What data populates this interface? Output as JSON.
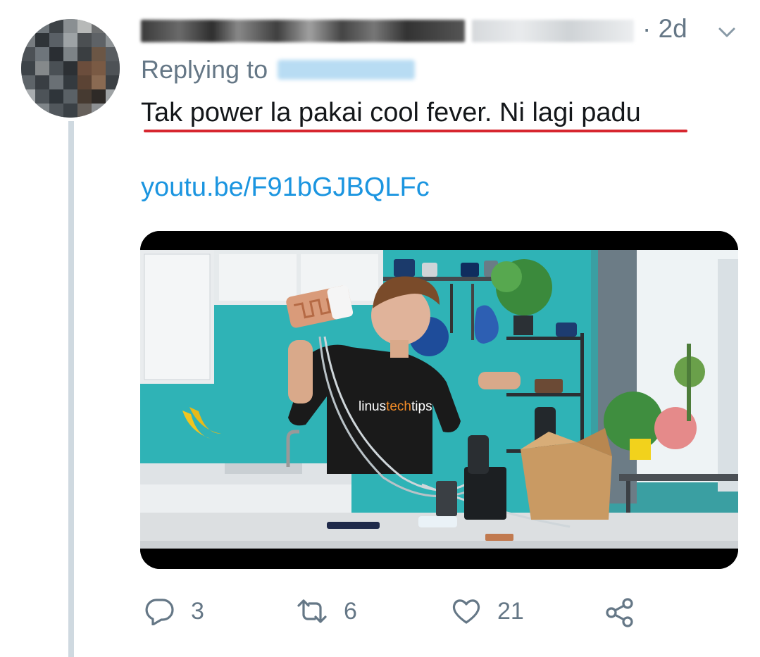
{
  "tweet": {
    "timestamp": "· 2d",
    "reply_prefix": "Replying to",
    "text": "Tak power la pakai cool fever. Ni lagi padu",
    "link": "youtu.be/F91bGJBQLFc",
    "thumbnail": {
      "shirt_text_part1": "linus",
      "shirt_text_part2": "tech",
      "shirt_text_part3": "tips"
    },
    "actions": {
      "reply_count": "3",
      "retweet_count": "6",
      "like_count": "21"
    }
  },
  "colors": {
    "link": "#1b95e0",
    "secondary_text": "#657786",
    "highlight_underline": "#d7262f",
    "thread_line": "#cfd9e0",
    "wall_teal": "#2fb3b6"
  },
  "icons": [
    "chevron-down-icon",
    "reply-icon",
    "retweet-icon",
    "like-icon",
    "share-icon"
  ]
}
